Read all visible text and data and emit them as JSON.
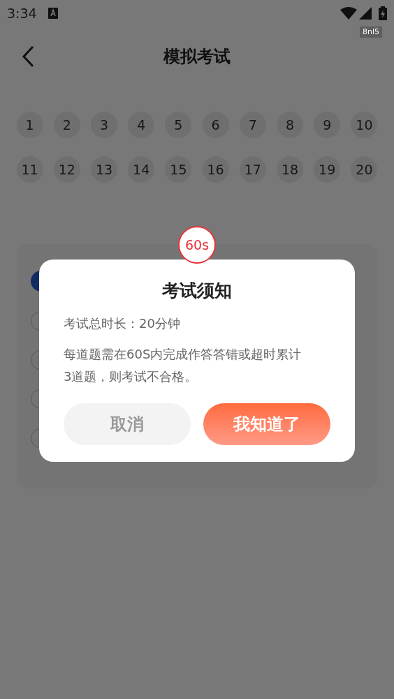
{
  "status_bar": {
    "time": "3:34",
    "tag": "8nl5"
  },
  "header": {
    "title": "模拟考试"
  },
  "question_numbers": [
    "1",
    "2",
    "3",
    "4",
    "5",
    "6",
    "7",
    "8",
    "9",
    "10",
    "11",
    "12",
    "13",
    "14",
    "15",
    "16",
    "17",
    "18",
    "19",
    "20"
  ],
  "timer": "60s",
  "dialog": {
    "title": "考试须知",
    "lines": [
      "考试总时长：20分钟",
      "每道题需在60S内完成作答答错或超时累计3道题，则考试不合格。"
    ],
    "buttons": [
      {
        "label": "取消",
        "kind": "secondary"
      },
      {
        "label": "我知道了",
        "kind": "primary"
      }
    ]
  }
}
